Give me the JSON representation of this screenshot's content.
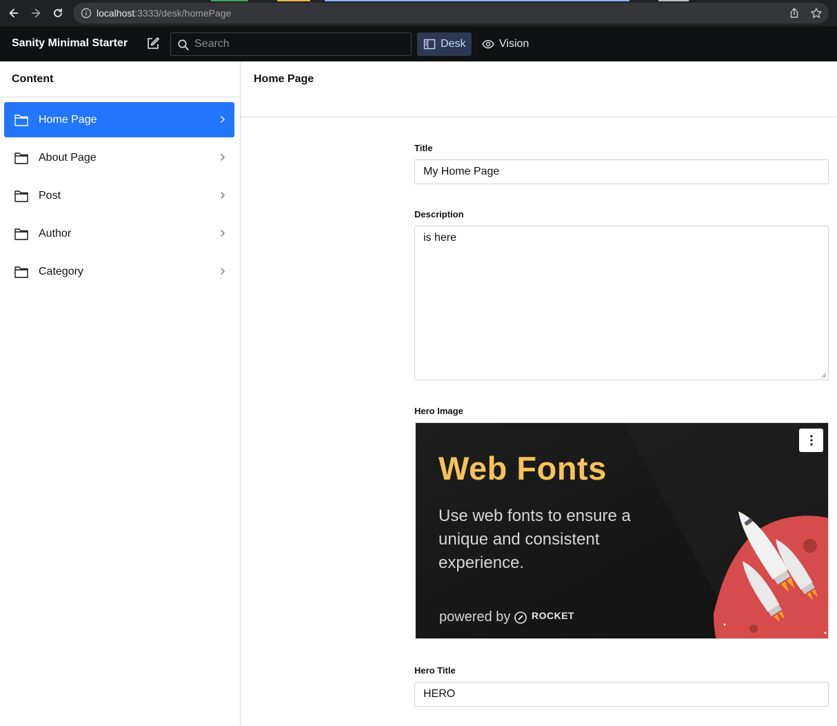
{
  "browser": {
    "url_host": "localhost",
    "url_path": ":3333/desk/homePage"
  },
  "navbar": {
    "brand": "Sanity Minimal Starter",
    "search_placeholder": "Search",
    "tools": [
      {
        "label": "Desk",
        "icon": "desk-icon",
        "active": true
      },
      {
        "label": "Vision",
        "icon": "eye-icon",
        "active": false
      }
    ]
  },
  "content_pane": {
    "title": "Content",
    "items": [
      {
        "label": "Home Page",
        "icon": "folder-icon",
        "selected": true
      },
      {
        "label": "About Page",
        "icon": "folder-icon",
        "selected": false
      },
      {
        "label": "Post",
        "icon": "folder-icon",
        "selected": false
      },
      {
        "label": "Author",
        "icon": "folder-icon",
        "selected": false
      },
      {
        "label": "Category",
        "icon": "folder-icon",
        "selected": false
      }
    ]
  },
  "document": {
    "title": "Home Page",
    "fields": {
      "title_label": "Title",
      "title_value": "My Home Page",
      "description_label": "Description",
      "description_value": "is here",
      "hero_image_label": "Hero Image",
      "hero_title_label": "Hero Title",
      "hero_title_value": "HERO"
    },
    "hero_image": {
      "headline": "Web Fonts",
      "subtext": "Use web fonts to ensure a unique and consistent experience.",
      "powered_by": "powered by",
      "brand": "ROCKET"
    }
  },
  "colors": {
    "accent": "#2276fc",
    "navbar_bg": "#101112",
    "hero_headline": "#f5c35a",
    "hero_planet": "#d64b4b"
  }
}
